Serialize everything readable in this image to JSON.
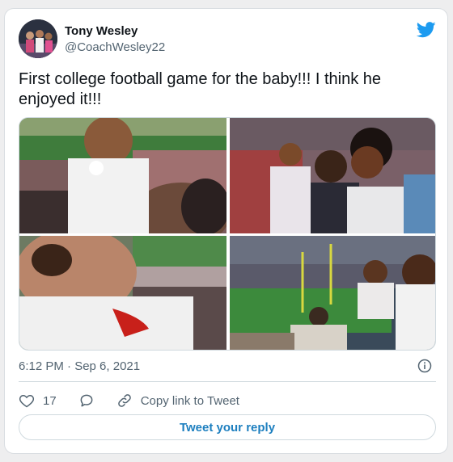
{
  "author": {
    "name": "Tony Wesley",
    "handle": "@CoachWesley22"
  },
  "tweet": {
    "text": "First college football game for the baby!!! I think he enjoyed it!!!",
    "timestamp": "6:12 PM · Sep 6, 2021"
  },
  "media": {
    "photo_count": 4
  },
  "actions": {
    "like_count": "17",
    "copy_link_label": "Copy link to Tweet"
  },
  "reply": {
    "label": "Tweet your reply"
  },
  "colors": {
    "brand": "#1d9bf0",
    "secondary_text": "#536471",
    "border": "#cfd9de"
  },
  "icons": [
    "twitter-bird-icon",
    "info-icon",
    "heart-icon",
    "reply-bubble-icon",
    "link-icon"
  ]
}
